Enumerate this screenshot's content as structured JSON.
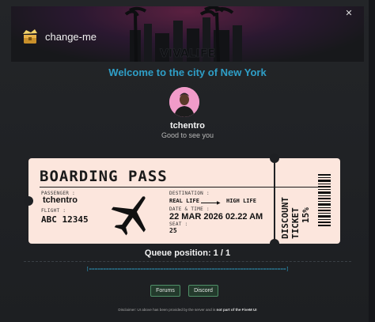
{
  "header": {
    "server_name": "change-me",
    "banner_text": "VIVALIFE",
    "close_glyph": "✕"
  },
  "welcome": {
    "message": "Welcome to the city of New York"
  },
  "profile": {
    "username": "tchentro",
    "greeting": "Good to see you",
    "avatar_bg": "#f19bc9"
  },
  "ticket": {
    "title": "BOARDING PASS",
    "passenger_label": "PASSENGER :",
    "passenger_value": "tchentro",
    "flight_label": "FLIGHT :",
    "flight_value": "ABC 12345",
    "destination_label": "DESTINATION :",
    "destination_from": "REAL LIFE",
    "destination_to": "HIGH LIFE",
    "datetime_label": "DATE & TIME :",
    "datetime_value": "22 MAR 2026 02.22 AM",
    "seat_label": "SEAT :",
    "seat_value": "25",
    "stub_line1": "DISCOUNT",
    "stub_line2": "TICKET",
    "stub_line3": "15%",
    "paper_color": "#fce6dd"
  },
  "queue": {
    "text": "Queue position: 1 / 1",
    "progress_bar": "[=====================================================================]"
  },
  "buttons": {
    "forums": "Forums",
    "discord": "Discord"
  },
  "footer": {
    "disclaimer_prefix": "Disclaimer: UI above has been provided by the server and is",
    "disclaimer_bold": "not part of the FiveM UI"
  },
  "colors": {
    "accent": "#2f9fc7",
    "button_border": "#4f8f67"
  }
}
